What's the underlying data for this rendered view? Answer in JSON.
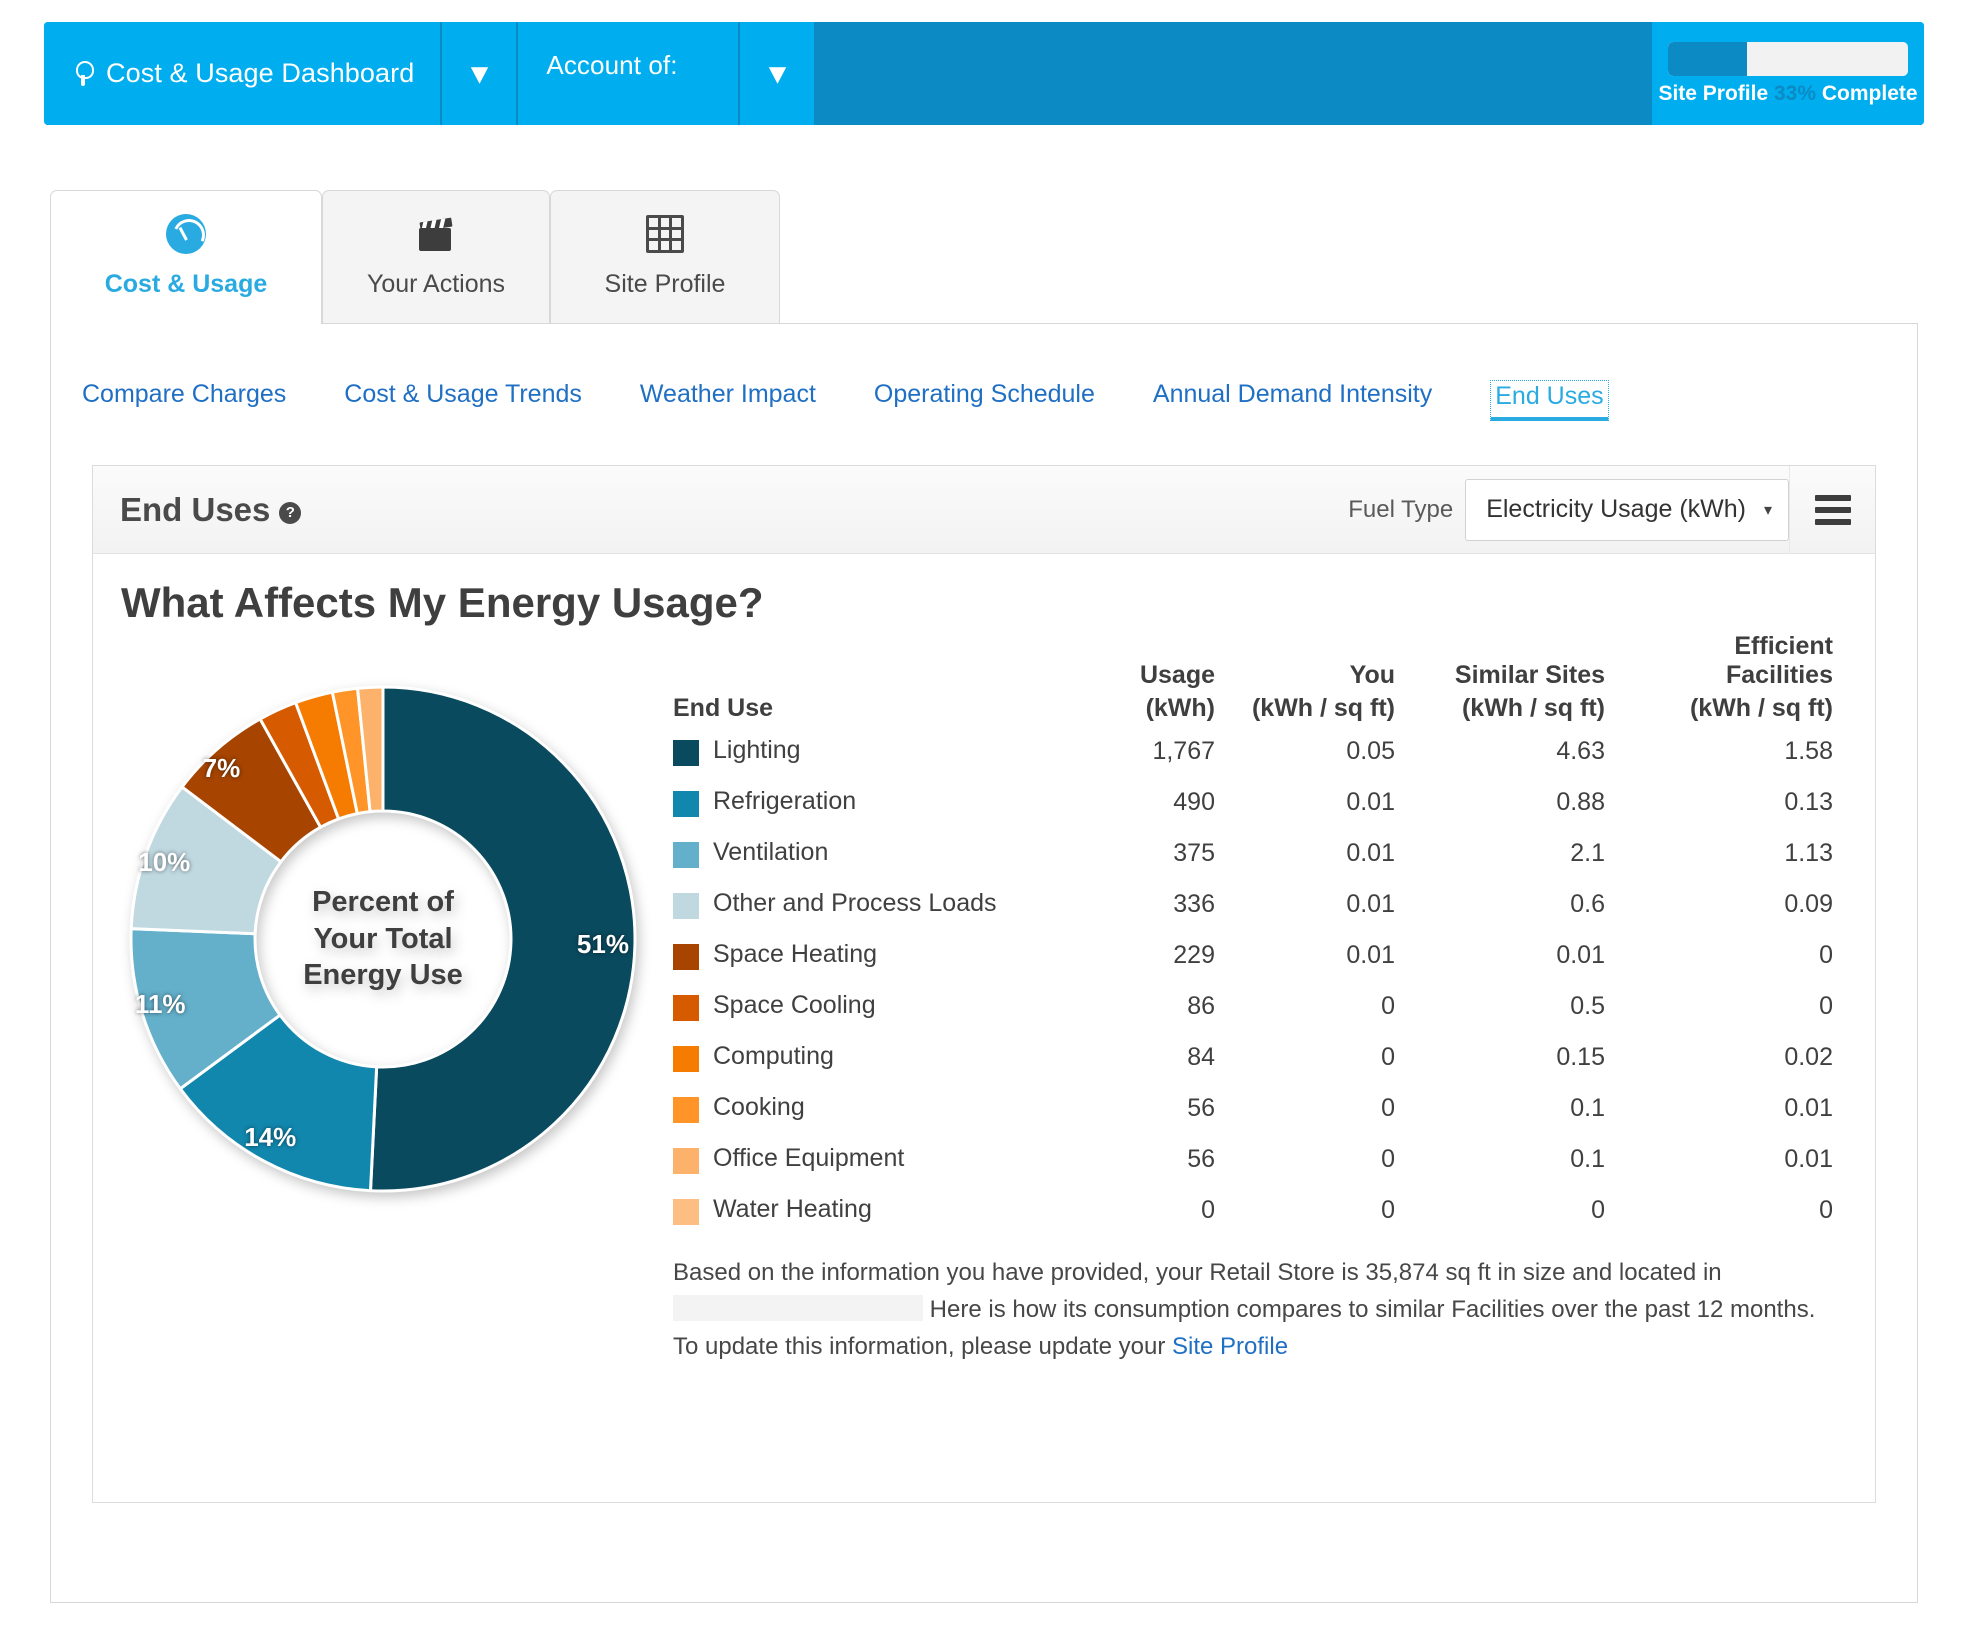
{
  "topbar": {
    "dashboard_label": "Cost & Usage Dashboard",
    "dashboard_icon": "lightbulb-icon",
    "account_label": "Account of:",
    "caret_glyph": "⌄",
    "progress": {
      "prefix": "Site Profile",
      "percent": "33%",
      "suffix": "Complete",
      "value": 33,
      "fill_color": "#0b8ac4",
      "track_color": "#f2f2f2"
    },
    "bg_color": "#00aeef",
    "accent_color": "#0b8ac4"
  },
  "tabs": [
    {
      "label": "Cost & Usage",
      "icon": "gauge-icon",
      "active": true
    },
    {
      "label": "Your Actions",
      "icon": "clapperboard-icon",
      "active": false
    },
    {
      "label": "Site Profile",
      "icon": "grid-icon",
      "active": false
    }
  ],
  "subnav": [
    {
      "label": "Compare Charges",
      "active": false
    },
    {
      "label": "Cost & Usage Trends",
      "active": false
    },
    {
      "label": "Weather Impact",
      "active": false
    },
    {
      "label": "Operating Schedule",
      "active": false
    },
    {
      "label": "Annual Demand Intensity",
      "active": false
    },
    {
      "label": "End Uses",
      "active": true
    }
  ],
  "widget": {
    "title": "End Uses",
    "help_glyph": "?",
    "fuel_type_label": "Fuel Type",
    "fuel_type_value": "Electricity Usage (kWh)",
    "dropdown_caret": "▾",
    "menu_icon": "hamburger-menu-icon"
  },
  "chart_data": {
    "type": "pie",
    "title": "What Affects My Energy Usage?",
    "center_label": "Percent of\nYour Total\nEnergy Use",
    "center_label_lines": [
      "Percent of",
      "Your Total",
      "Energy Use"
    ],
    "categories": [
      "Lighting",
      "Refrigeration",
      "Ventilation",
      "Other and Process Loads",
      "Space Heating",
      "Space Cooling",
      "Computing",
      "Cooking",
      "Office Equipment",
      "Water Heating"
    ],
    "values": [
      1767,
      490,
      375,
      336,
      229,
      86,
      84,
      56,
      56,
      0
    ],
    "percentages": [
      51,
      14,
      11,
      10,
      7,
      2.5,
      2.4,
      1.6,
      1.6,
      0
    ],
    "displayed_percent_labels": [
      "51%",
      "14%",
      "11%",
      "10%",
      "7%"
    ],
    "colors": [
      "#0a4a5e",
      "#1187ad",
      "#64afca",
      "#c0d8e0",
      "#a64400",
      "#d65a00",
      "#f57c00",
      "#ff9528",
      "#fcb26a",
      "#fcbe82"
    ],
    "unit": "kWh",
    "legend_position": "right-table"
  },
  "table": {
    "header_top": [
      "",
      "Usage",
      "You",
      "Similar Sites",
      "Efficient"
    ],
    "header_eff_second_line": "Facilities",
    "header_bottom": [
      "End Use",
      "(kWh)",
      "(kWh / sq ft)",
      "(kWh / sq ft)",
      "(kWh / sq ft)"
    ],
    "rows": [
      {
        "end_use": "Lighting",
        "color": "#0a4a5e",
        "usage": "1,767",
        "you": "0.05",
        "similar": "4.63",
        "efficient": "1.58"
      },
      {
        "end_use": "Refrigeration",
        "color": "#1187ad",
        "usage": "490",
        "you": "0.01",
        "similar": "0.88",
        "efficient": "0.13"
      },
      {
        "end_use": "Ventilation",
        "color": "#64afca",
        "usage": "375",
        "you": "0.01",
        "similar": "2.1",
        "efficient": "1.13"
      },
      {
        "end_use": "Other and Process Loads",
        "color": "#c0d8e0",
        "usage": "336",
        "you": "0.01",
        "similar": "0.6",
        "efficient": "0.09"
      },
      {
        "end_use": "Space Heating",
        "color": "#a64400",
        "usage": "229",
        "you": "0.01",
        "similar": "0.01",
        "efficient": "0"
      },
      {
        "end_use": "Space Cooling",
        "color": "#d65a00",
        "usage": "86",
        "you": "0",
        "similar": "0.5",
        "efficient": "0"
      },
      {
        "end_use": "Computing",
        "color": "#f57c00",
        "usage": "84",
        "you": "0",
        "similar": "0.15",
        "efficient": "0.02"
      },
      {
        "end_use": "Cooking",
        "color": "#ff9528",
        "usage": "56",
        "you": "0",
        "similar": "0.1",
        "efficient": "0.01"
      },
      {
        "end_use": "Office Equipment",
        "color": "#fcb26a",
        "usage": "56",
        "you": "0",
        "similar": "0.1",
        "efficient": "0.01"
      },
      {
        "end_use": "Water Heating",
        "color": "#fcbe82",
        "usage": "0",
        "you": "0",
        "similar": "0",
        "efficient": "0"
      }
    ]
  },
  "note": {
    "part1": "Based on the information you have provided, your Retail Store is 35,874 sq ft in size and located in",
    "part2": "Here is how its consumption compares to similar Facilities over the past 12 months.",
    "part3": "To update this information, please update your",
    "link": "Site Profile"
  }
}
